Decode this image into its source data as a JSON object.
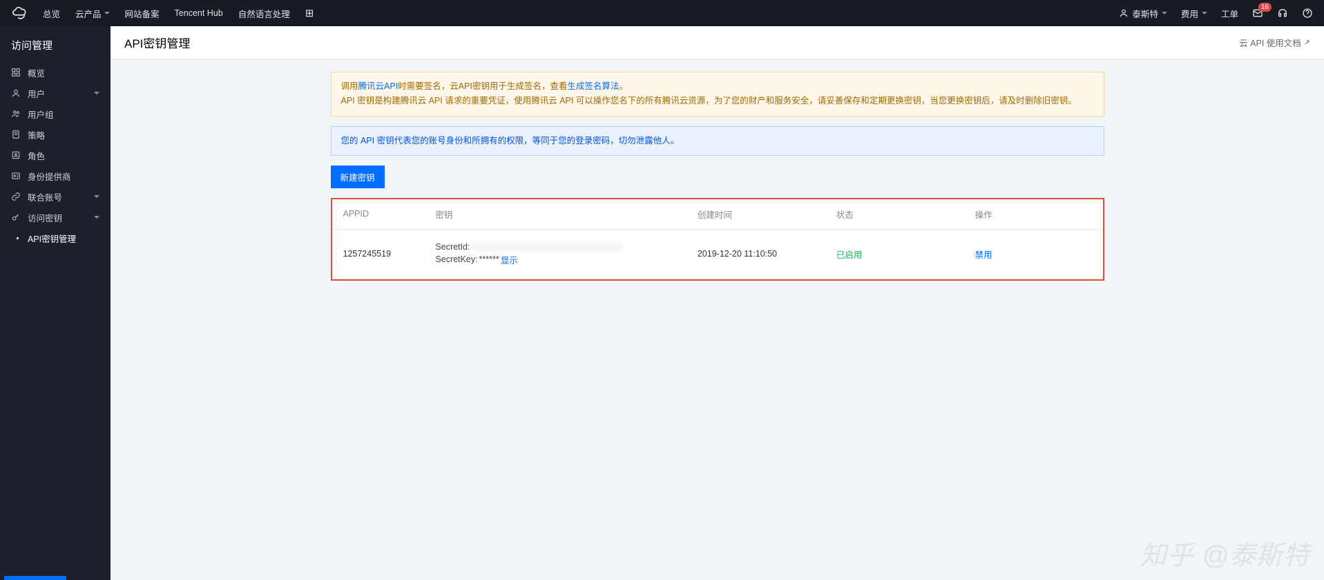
{
  "topnav": {
    "left": {
      "overview": "总览",
      "cloud_products": "云产品",
      "website_beian": "网站备案",
      "tencent_hub": "Tencent Hub",
      "nlp": "自然语言处理"
    },
    "right": {
      "user_name": "泰斯特",
      "fees": "费用",
      "work_order": "工单",
      "msg_badge": "16"
    }
  },
  "sidebar": {
    "title": "访问管理",
    "items": [
      {
        "label": "概览"
      },
      {
        "label": "用户",
        "expandable": true
      },
      {
        "label": "用户组"
      },
      {
        "label": "策略"
      },
      {
        "label": "角色"
      },
      {
        "label": "身份提供商"
      },
      {
        "label": "联合账号",
        "expandable": true
      },
      {
        "label": "访问密钥",
        "expandable": true
      }
    ],
    "subitem": "API密钥管理"
  },
  "page": {
    "title": "API密钥管理",
    "doc_link": "云 API 使用文档"
  },
  "alerts": {
    "warn_prefix": "调用",
    "warn_link1": "腾讯云API",
    "warn_mid1": "时需要签名，云API密钥用于生成签名，查看",
    "warn_link2": "生成签名算法",
    "warn_mid2": "。",
    "warn_line2": "API 密钥是构建腾讯云 API 请求的重要凭证，使用腾讯云 API 可以操作您名下的所有腾讯云资源，为了您的财产和服务安全，请妥善保存和定期更换密钥，当您更换密钥后，请及时删除旧密钥。",
    "info": "您的 API 密钥代表您的账号身份和所拥有的权限，等同于您的登录密码，切勿泄露他人。"
  },
  "actions": {
    "create_key": "新建密钥"
  },
  "table": {
    "headers": {
      "appid": "APPID",
      "secret": "密钥",
      "created": "创建时间",
      "status": "状态",
      "ops": "操作"
    },
    "row": {
      "appid": "1257245519",
      "secret_id_label": "SecretId:",
      "secret_key_label": "SecretKey:",
      "secret_key_mask": "******",
      "show": "显示",
      "created": "2019-12-20 11:10:50",
      "status": "已启用",
      "disable": "禁用"
    }
  },
  "watermark": "知乎 @泰斯特"
}
